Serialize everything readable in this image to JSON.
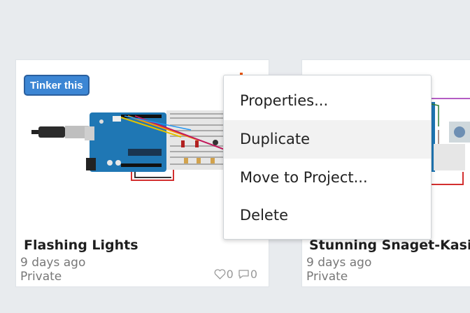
{
  "cards": [
    {
      "title": "Flashing Lights",
      "date": "9 days ago",
      "visibility": "Private",
      "tinker_label": "Tinker this",
      "likes": "0",
      "comments": "0"
    },
    {
      "title": "Stunning Snaget-Kasi",
      "date": "9 days ago",
      "visibility": "Private"
    }
  ],
  "context_menu": {
    "items": [
      "Properties...",
      "Duplicate",
      "Move to Project...",
      "Delete"
    ],
    "highlighted": "Duplicate"
  },
  "colors": {
    "page_bg": "#e8ebee",
    "tinker_button": "#3c86d4",
    "arduino_board": "#1f77b4",
    "breadboard": "#e6e6e6"
  },
  "icons": [
    "heart-icon",
    "comment-icon"
  ]
}
